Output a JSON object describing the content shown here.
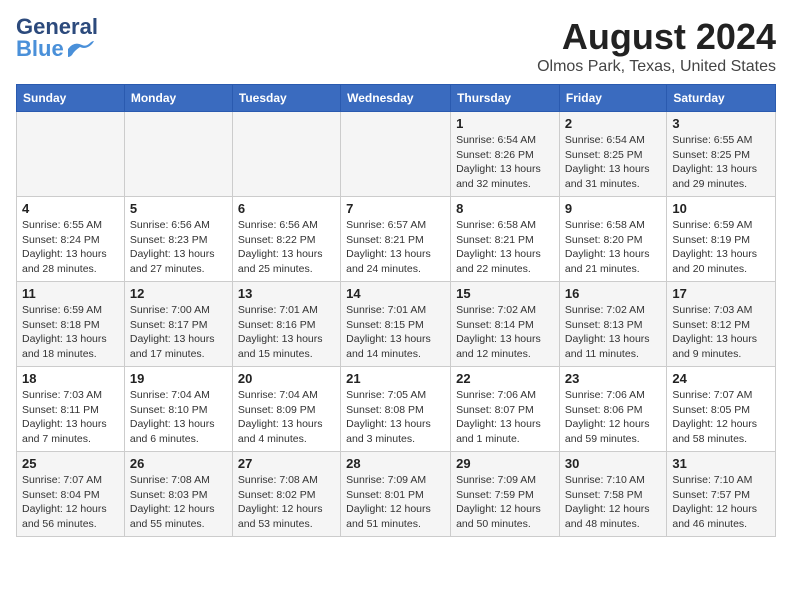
{
  "logo": {
    "general": "General",
    "blue": "Blue"
  },
  "title": "August 2024",
  "subtitle": "Olmos Park, Texas, United States",
  "days_of_week": [
    "Sunday",
    "Monday",
    "Tuesday",
    "Wednesday",
    "Thursday",
    "Friday",
    "Saturday"
  ],
  "weeks": [
    [
      {
        "day": "",
        "info": ""
      },
      {
        "day": "",
        "info": ""
      },
      {
        "day": "",
        "info": ""
      },
      {
        "day": "",
        "info": ""
      },
      {
        "day": "1",
        "info": "Sunrise: 6:54 AM\nSunset: 8:26 PM\nDaylight: 13 hours and 32 minutes."
      },
      {
        "day": "2",
        "info": "Sunrise: 6:54 AM\nSunset: 8:25 PM\nDaylight: 13 hours and 31 minutes."
      },
      {
        "day": "3",
        "info": "Sunrise: 6:55 AM\nSunset: 8:25 PM\nDaylight: 13 hours and 29 minutes."
      }
    ],
    [
      {
        "day": "4",
        "info": "Sunrise: 6:55 AM\nSunset: 8:24 PM\nDaylight: 13 hours and 28 minutes."
      },
      {
        "day": "5",
        "info": "Sunrise: 6:56 AM\nSunset: 8:23 PM\nDaylight: 13 hours and 27 minutes."
      },
      {
        "day": "6",
        "info": "Sunrise: 6:56 AM\nSunset: 8:22 PM\nDaylight: 13 hours and 25 minutes."
      },
      {
        "day": "7",
        "info": "Sunrise: 6:57 AM\nSunset: 8:21 PM\nDaylight: 13 hours and 24 minutes."
      },
      {
        "day": "8",
        "info": "Sunrise: 6:58 AM\nSunset: 8:21 PM\nDaylight: 13 hours and 22 minutes."
      },
      {
        "day": "9",
        "info": "Sunrise: 6:58 AM\nSunset: 8:20 PM\nDaylight: 13 hours and 21 minutes."
      },
      {
        "day": "10",
        "info": "Sunrise: 6:59 AM\nSunset: 8:19 PM\nDaylight: 13 hours and 20 minutes."
      }
    ],
    [
      {
        "day": "11",
        "info": "Sunrise: 6:59 AM\nSunset: 8:18 PM\nDaylight: 13 hours and 18 minutes."
      },
      {
        "day": "12",
        "info": "Sunrise: 7:00 AM\nSunset: 8:17 PM\nDaylight: 13 hours and 17 minutes."
      },
      {
        "day": "13",
        "info": "Sunrise: 7:01 AM\nSunset: 8:16 PM\nDaylight: 13 hours and 15 minutes."
      },
      {
        "day": "14",
        "info": "Sunrise: 7:01 AM\nSunset: 8:15 PM\nDaylight: 13 hours and 14 minutes."
      },
      {
        "day": "15",
        "info": "Sunrise: 7:02 AM\nSunset: 8:14 PM\nDaylight: 13 hours and 12 minutes."
      },
      {
        "day": "16",
        "info": "Sunrise: 7:02 AM\nSunset: 8:13 PM\nDaylight: 13 hours and 11 minutes."
      },
      {
        "day": "17",
        "info": "Sunrise: 7:03 AM\nSunset: 8:12 PM\nDaylight: 13 hours and 9 minutes."
      }
    ],
    [
      {
        "day": "18",
        "info": "Sunrise: 7:03 AM\nSunset: 8:11 PM\nDaylight: 13 hours and 7 minutes."
      },
      {
        "day": "19",
        "info": "Sunrise: 7:04 AM\nSunset: 8:10 PM\nDaylight: 13 hours and 6 minutes."
      },
      {
        "day": "20",
        "info": "Sunrise: 7:04 AM\nSunset: 8:09 PM\nDaylight: 13 hours and 4 minutes."
      },
      {
        "day": "21",
        "info": "Sunrise: 7:05 AM\nSunset: 8:08 PM\nDaylight: 13 hours and 3 minutes."
      },
      {
        "day": "22",
        "info": "Sunrise: 7:06 AM\nSunset: 8:07 PM\nDaylight: 13 hours and 1 minute."
      },
      {
        "day": "23",
        "info": "Sunrise: 7:06 AM\nSunset: 8:06 PM\nDaylight: 12 hours and 59 minutes."
      },
      {
        "day": "24",
        "info": "Sunrise: 7:07 AM\nSunset: 8:05 PM\nDaylight: 12 hours and 58 minutes."
      }
    ],
    [
      {
        "day": "25",
        "info": "Sunrise: 7:07 AM\nSunset: 8:04 PM\nDaylight: 12 hours and 56 minutes."
      },
      {
        "day": "26",
        "info": "Sunrise: 7:08 AM\nSunset: 8:03 PM\nDaylight: 12 hours and 55 minutes."
      },
      {
        "day": "27",
        "info": "Sunrise: 7:08 AM\nSunset: 8:02 PM\nDaylight: 12 hours and 53 minutes."
      },
      {
        "day": "28",
        "info": "Sunrise: 7:09 AM\nSunset: 8:01 PM\nDaylight: 12 hours and 51 minutes."
      },
      {
        "day": "29",
        "info": "Sunrise: 7:09 AM\nSunset: 7:59 PM\nDaylight: 12 hours and 50 minutes."
      },
      {
        "day": "30",
        "info": "Sunrise: 7:10 AM\nSunset: 7:58 PM\nDaylight: 12 hours and 48 minutes."
      },
      {
        "day": "31",
        "info": "Sunrise: 7:10 AM\nSunset: 7:57 PM\nDaylight: 12 hours and 46 minutes."
      }
    ]
  ]
}
